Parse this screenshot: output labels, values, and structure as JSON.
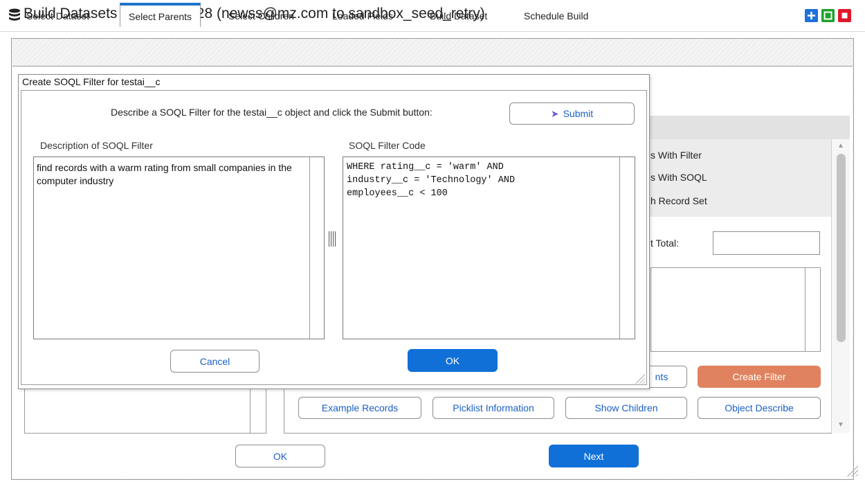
{
  "window": {
    "title": "Build Datasets For Push_228 (newss@mz.com to sandbox_seed_retry)",
    "icon": "database-icon",
    "controls": [
      "add-icon",
      "maximize-icon",
      "close-icon"
    ],
    "colors": {
      "add": "#1e6fd9",
      "maximize": "#1ea22e",
      "close": "#e0192a"
    }
  },
  "tabs": [
    {
      "label": "Select Dataset"
    },
    {
      "label": "Select Parents",
      "active": true
    },
    {
      "label": "Select Children"
    },
    {
      "label": "Loaded Fields"
    },
    {
      "label": "Build Dataset"
    },
    {
      "label": "Schedule Build"
    }
  ],
  "background_panel": {
    "list_items": [
      "s With Filter",
      "s With SOQL",
      "h Record Set"
    ],
    "total_label": "t Total:",
    "total_value": "",
    "buttons": {
      "partial_left": "nts",
      "create_filter": "Create Filter",
      "example_records": "Example Records",
      "picklist_information": "Picklist Information",
      "show_children": "Show Children",
      "object_describe": "Object Describe"
    },
    "accent_colors": {
      "primary": "#1070d8",
      "create_filter": "#e0825f"
    }
  },
  "footer": {
    "ok": "OK",
    "next": "Next"
  },
  "dialog": {
    "title": "Create SOQL Filter for testai__c",
    "prompt": "Describe a SOQL Filter for the testai__c object and click the Submit button:",
    "submit_label": "Submit",
    "description_label": "Description of SOQL Filter",
    "description_value": "find records with a warm rating from small companies in the computer industry",
    "code_label": "SOQL Filter Code",
    "code_value": "WHERE rating__c = 'warm' AND\nindustry__c = 'Technology' AND\nemployees__c < 100",
    "cancel_label": "Cancel",
    "ok_label": "OK"
  }
}
